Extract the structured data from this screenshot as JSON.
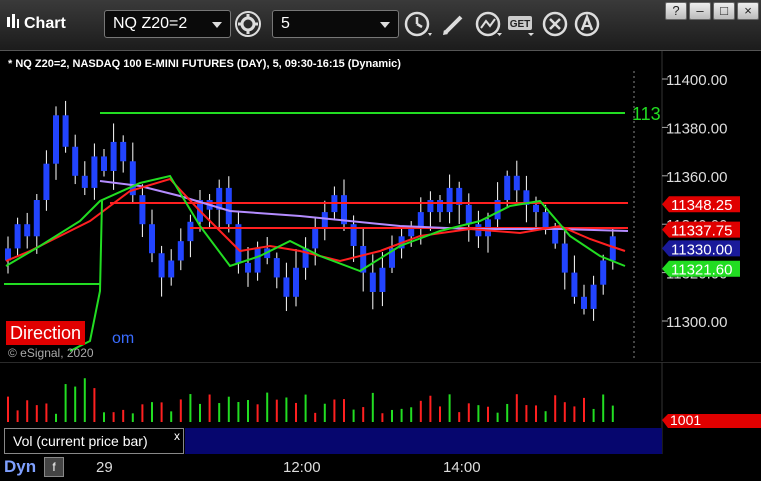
{
  "toolbar": {
    "title": "Chart",
    "symbol": "NQ Z20=2",
    "interval": "5",
    "get_label": "GET"
  },
  "chart": {
    "description": "* NQ Z20=2, NASDAQ 100 E-MINI FUTURES (DAY), 5, 09:30-16:15 (Dynamic)",
    "price_ticks": [
      "11400.00",
      "11380.00",
      "11360.00",
      "11340.00",
      "11320.00",
      "11300.00"
    ],
    "green_line_label": "113",
    "price_markers": [
      {
        "value": "11348.25",
        "color": "#e00000"
      },
      {
        "value": "11337.75",
        "color": "#e00000"
      },
      {
        "value": "11330.00",
        "color": "#1a1a9a"
      },
      {
        "value": "11321.60",
        "color": "#22dd22"
      }
    ],
    "direction_label": "Direction",
    "link_fragment": "om",
    "copyright": "© eSignal, 2020",
    "volume_marker": "1001",
    "volume_label": "Vol (current price bar)",
    "close_glyph": "x",
    "x_ticks": [
      "29",
      "12:00",
      "14:00"
    ],
    "dyn_label": "Dyn",
    "colors": {
      "up_candle": "#2244ff",
      "down_candle": "#2244ff",
      "wick": "#ffffff",
      "green_line": "#22dd22",
      "red_line": "#ff2020",
      "purple_line": "#b48cff"
    }
  }
}
